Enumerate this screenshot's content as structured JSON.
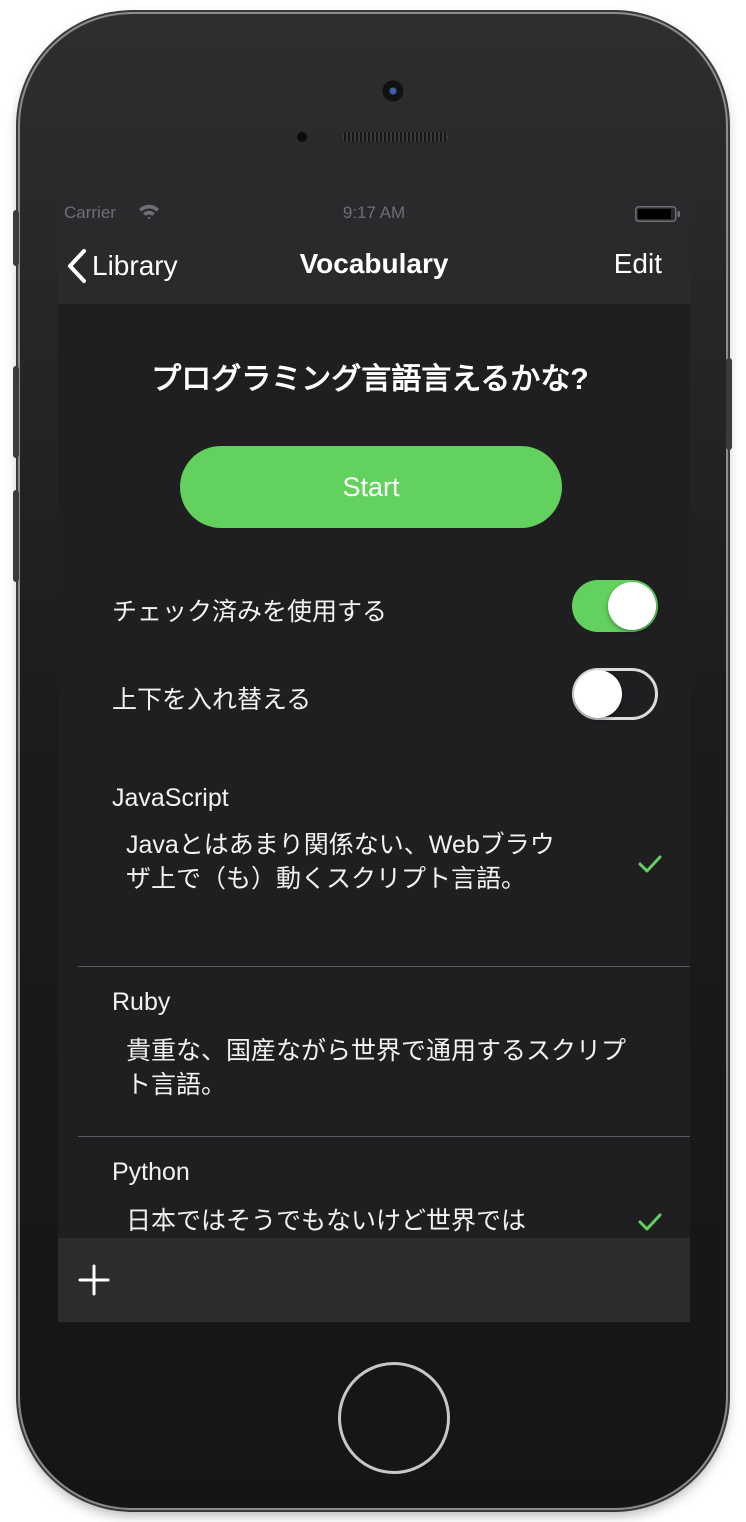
{
  "status_bar": {
    "carrier": "Carrier",
    "time": "9:17 AM"
  },
  "nav": {
    "back_label": "Library",
    "title": "Vocabulary",
    "edit_label": "Edit"
  },
  "quiz": {
    "title": "プログラミング言語言えるかな?",
    "start_label": "Start"
  },
  "settings": [
    {
      "label": "チェック済みを使用する",
      "on": true
    },
    {
      "label": "上下を入れ替える",
      "on": false
    }
  ],
  "items": [
    {
      "term": "JavaScript",
      "definition": "Javaとはあまり関係ない、Webブラウザ上で（も）動くスクリプト言語。",
      "checked": true
    },
    {
      "term": "Ruby",
      "definition": "貴重な、国産ながら世界で通用するスクリプト言語。",
      "checked": false
    },
    {
      "term": "Python",
      "definition": "日本ではそうでもないけど世界では",
      "checked": true
    }
  ],
  "colors": {
    "accent_green": "#62d15e",
    "background": "#1f1f22",
    "bar": "#2a2a2d"
  },
  "icons": {
    "back": "chevron-left-icon",
    "add": "plus-icon",
    "check": "checkmark-icon",
    "wifi": "wifi-icon",
    "battery": "battery-icon"
  }
}
